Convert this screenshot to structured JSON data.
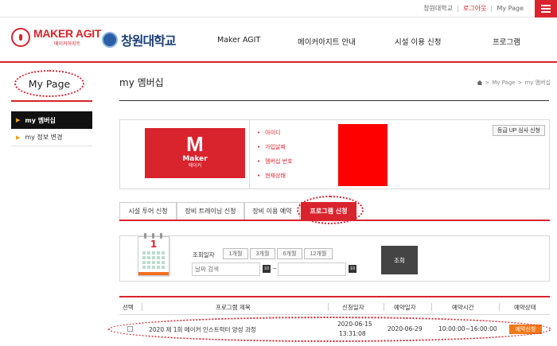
{
  "topbar": {
    "links": [
      "창원대학교",
      "로그아웃",
      "My Page"
    ]
  },
  "header": {
    "logo_maker_title": "MAKER AGIT",
    "logo_maker_sub": "메이커아지트",
    "logo_university": "창원대학교",
    "nav": [
      "Maker AGIT",
      "메이커아지트 안내",
      "시설 이용 신청",
      "프로그램"
    ]
  },
  "sidebar": {
    "title": "My Page",
    "items": [
      {
        "label": "my 멤버십",
        "active": true
      },
      {
        "label": "my 정보 변경",
        "active": false
      }
    ]
  },
  "content": {
    "title": "my 멤버십",
    "breadcrumb": [
      "My Page",
      "my 멤버십"
    ]
  },
  "membership": {
    "card_letter": "M",
    "card_name": "Maker",
    "card_sub": "메이커",
    "fields": [
      "아이디",
      "가입날짜",
      "멤버십 번호",
      "현재상태"
    ],
    "upgrade_label": "등급 UP 심사 신청"
  },
  "tabs": [
    {
      "label": "시설 투어 신청",
      "active": false
    },
    {
      "label": "장비 트레이닝 신청",
      "active": false
    },
    {
      "label": "장비 이용 예약",
      "active": false
    },
    {
      "label": "프로그램 신청",
      "active": true
    }
  ],
  "search": {
    "calendar_day": "1",
    "label": "조회일자",
    "periods": [
      "1개월",
      "3개월",
      "6개월",
      "12개월"
    ],
    "start_placeholder": "날짜 검색",
    "end_placeholder": "",
    "calendar_button": "10",
    "tilde": "~",
    "submit_label": "조회"
  },
  "table": {
    "headers": [
      "선택",
      "프로그램 제목",
      "신청일자",
      "예약일자",
      "예약시간",
      "예약상태"
    ],
    "rows": [
      {
        "title": "2020 제 1회 메이커 인스트럭터 양성 과정",
        "applied_date": "2020-06-15",
        "applied_time": "13:31:08",
        "reserved_date": "2020-06-29",
        "reserved_time": "10:00:00~16:00:00",
        "status": "예약신청"
      }
    ]
  },
  "colors": {
    "accent": "#d9232d",
    "status_badge": "#f07a1a",
    "redacted": "#ff0000"
  }
}
